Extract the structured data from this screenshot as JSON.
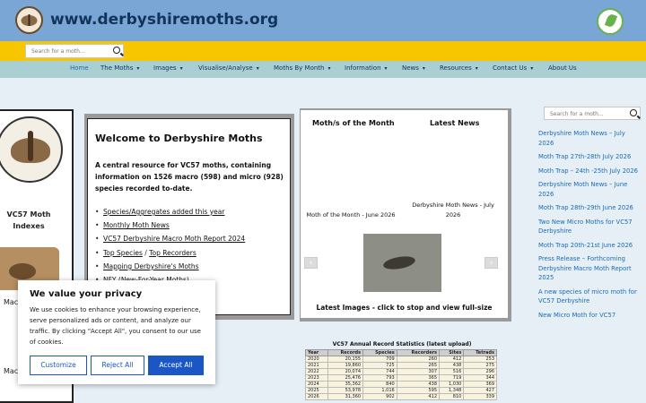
{
  "header": {
    "site_title": "www.derbyshiremoths.org",
    "search_placeholder": "Search for a moth..."
  },
  "nav": {
    "items": [
      {
        "label": "Home",
        "dropdown": false,
        "active": true
      },
      {
        "label": "The Moths",
        "dropdown": true
      },
      {
        "label": "Images",
        "dropdown": true
      },
      {
        "label": "Visualise/Analyse",
        "dropdown": true
      },
      {
        "label": "Moths By Month",
        "dropdown": true
      },
      {
        "label": "Information",
        "dropdown": true
      },
      {
        "label": "News",
        "dropdown": true
      },
      {
        "label": "Resources",
        "dropdown": true
      },
      {
        "label": "Contact Us",
        "dropdown": true
      },
      {
        "label": "About Us",
        "dropdown": false
      }
    ],
    "caret": "▾"
  },
  "left_panel": {
    "title": "VC57 Moth Indexes",
    "caption_1": "Mac",
    "caption_2": "Mac"
  },
  "welcome": {
    "title": "Welcome to Derbyshire Moths",
    "intro": "A central resource for VC57 moths, containing information on 1526 macro (598) and micro (928) species recorded to-date.",
    "links": [
      {
        "parts": [
          "Species/Aggregates added this year"
        ]
      },
      {
        "parts": [
          "Monthly Moth News"
        ]
      },
      {
        "parts": [
          "VC57 Derbyshire Macro Moth Report 2024"
        ]
      },
      {
        "parts": [
          "Top Species",
          " / ",
          "Top Recorders"
        ]
      },
      {
        "parts": [
          "Mapping Derbyshire's Moths"
        ]
      },
      {
        "parts": [
          "NFY (New-For-Year Moths)"
        ]
      }
    ]
  },
  "carousel": {
    "heading_left": "Moth/s of the Month",
    "heading_right": "Latest News",
    "caption_left": "Moth of the Month - June 2026",
    "caption_right": "Derbyshire Moth News - July 2026",
    "prev_icon": "‹",
    "next_icon": "›",
    "footer": "Latest Images - click to stop and view full-size"
  },
  "stats": {
    "title": "VC57 Annual Record Statistics (latest upload)",
    "headers": [
      "Year",
      "Records",
      "Species",
      "Recorders",
      "Sites",
      "Tetrads"
    ],
    "rows": [
      [
        "2020",
        "20,155",
        "709",
        "260",
        "412",
        "253"
      ],
      [
        "2021",
        "19,860",
        "725",
        "265",
        "438",
        "275"
      ],
      [
        "2022",
        "20,074",
        "744",
        "307",
        "516",
        "296"
      ],
      [
        "2023",
        "25,476",
        "793",
        "365",
        "719",
        "344"
      ],
      [
        "2024",
        "35,362",
        "840",
        "438",
        "1,030",
        "369"
      ],
      [
        "2025",
        "53,978",
        "1,016",
        "595",
        "1,348",
        "427"
      ],
      [
        "2026",
        "31,360",
        "902",
        "412",
        "810",
        "339"
      ]
    ]
  },
  "sidebar": {
    "search_placeholder": "Search for a moth...",
    "news": [
      "Derbyshire Moth News – July 2026",
      "Moth Trap 27th-28th July 2026",
      "Moth Trap – 24th -25th July 2026",
      "Derbyshire Moth News – June 2026",
      "Moth Trap 28th-29th June 2026",
      "Two New Micro Moths for VC57 Derbyshire",
      "Moth Trap 20th-21st June 2026",
      "Press Release – Forthcoming Derbyshire Macro Moth Report 2025",
      "A new species of micro moth for VC57 Derbyshire",
      "New Micro Moth for VC57"
    ]
  },
  "cookie": {
    "title": "We value your privacy",
    "text": "We use cookies to enhance your browsing experience, serve personalized ads or content, and analyze our traffic. By clicking \"Accept All\", you consent to our use of cookies.",
    "customize": "Customize",
    "reject": "Reject All",
    "accept": "Accept All"
  },
  "colors": {
    "header_bg": "#7aa6d6",
    "yellow_bar": "#f7c600",
    "nav_bg": "#a9cfd3",
    "link_blue": "#1a6cb5",
    "button_blue": "#1a56c4"
  }
}
